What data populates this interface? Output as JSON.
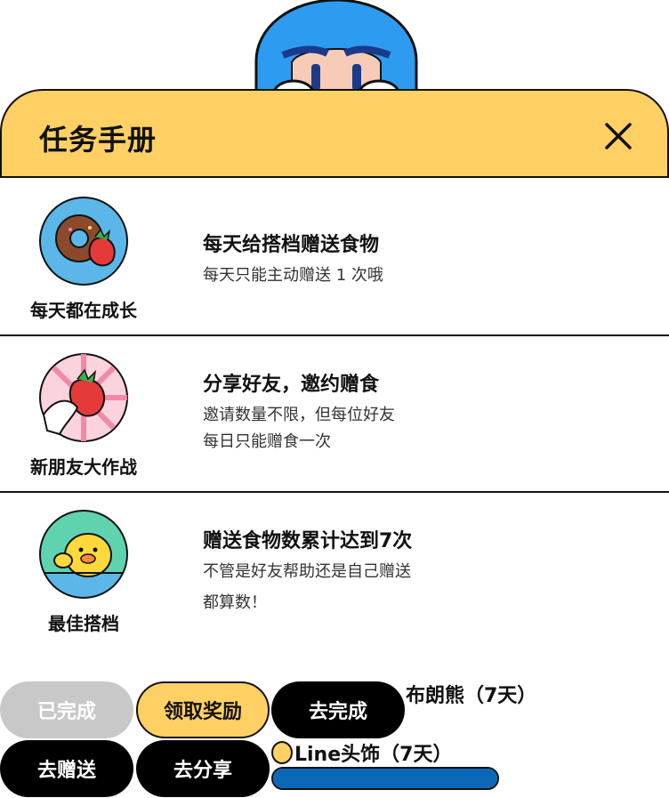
{
  "header": {
    "title": "任务手册"
  },
  "tasks": [
    {
      "caption": "每天都在成长",
      "title": "每天给搭档赠送食物",
      "desc": [
        "每天只能主动赠送 1 次哦"
      ]
    },
    {
      "caption": "新朋友大作战",
      "title": "分享好友，邀约赠食",
      "desc": [
        "邀请数量不限，但每位好友",
        "每日只能赠食一次"
      ]
    },
    {
      "caption": "最佳搭档",
      "title": "赠送食物数累计达到7次",
      "desc": [
        "不管是好友帮助还是自己赠送",
        "都算数！"
      ]
    }
  ],
  "buttons": {
    "done": "已完成",
    "claim": "领取奖励",
    "go_complete": "去完成",
    "go_gift": "去赠送",
    "go_share": "去分享"
  },
  "rewards": {
    "brown": "布朗熊（7天）",
    "line": "Line头饰（7天）"
  },
  "progress": {
    "fraction": 1.0
  },
  "colors": {
    "accent": "#ffd064",
    "dark": "#000000",
    "progress": "#0b67b8",
    "disabled": "#c8c8c8"
  }
}
